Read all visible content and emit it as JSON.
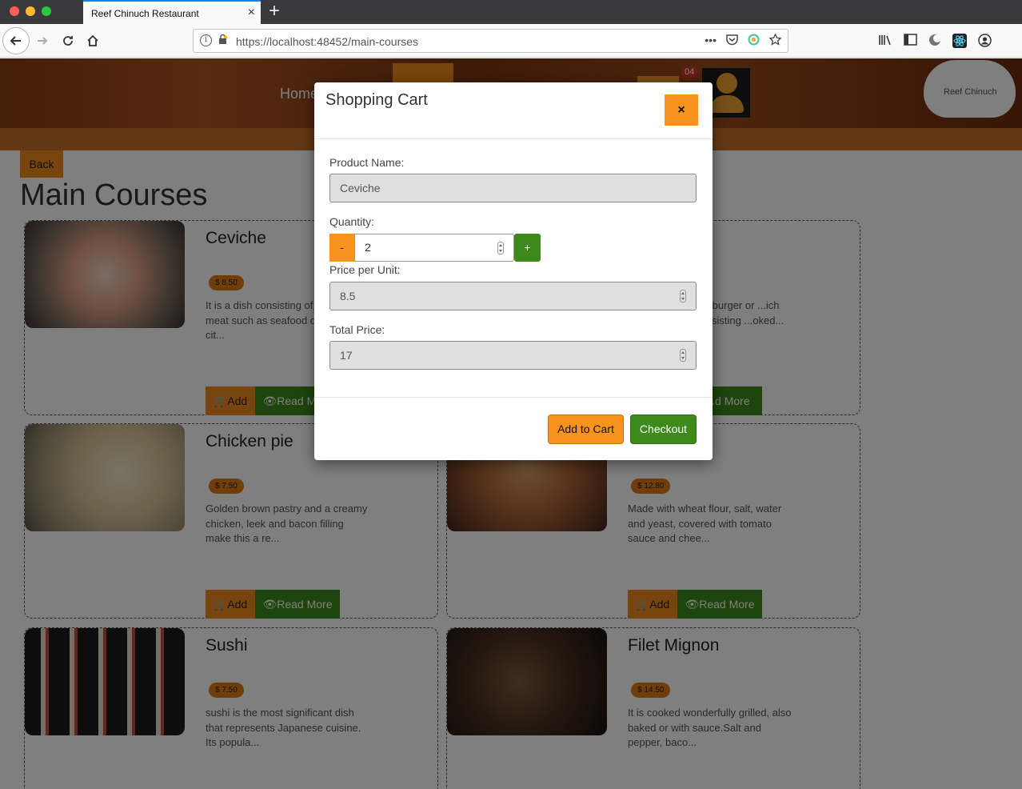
{
  "browser": {
    "tab_title": "Reef Chinuch Restaurant",
    "tab_close": "×",
    "new_tab": "+",
    "url": "https://localhost:48452/main-courses",
    "icons": [
      "back-icon",
      "forward-icon",
      "reload-icon",
      "home-icon",
      "info-icon",
      "lock-icon",
      "more-icon",
      "pocket-icon",
      "extension-icon",
      "star-icon",
      "library-icon",
      "sidebar-icon",
      "moon-icon",
      "react-icon",
      "account-icon"
    ]
  },
  "header": {
    "nav_home": "Home",
    "cart_count": "04",
    "logo_text": "Reef Chinuch"
  },
  "page": {
    "back_label": "Back",
    "title": "Main Courses"
  },
  "cards": [
    {
      "title": "Ceviche",
      "price": "$ 8.50",
      "desc": "It is a dish consisting of marinated meat such as seafood or both - in cit...",
      "add": "Add",
      "more": "Read More"
    },
    {
      "title": "",
      "price": "",
      "desc": "...efburger or ...ich consisting ...oked...",
      "add": "",
      "more": "...d More"
    },
    {
      "title": "Chicken pie",
      "price": "$ 7.50",
      "desc": "Golden brown pastry and a creamy chicken, leek and bacon filling make this a re...",
      "add": "Add",
      "more": "Read More"
    },
    {
      "title": "",
      "price": "$ 12.80",
      "desc": "Made with wheat flour, salt, water and yeast, covered with tomato sauce and chee...",
      "add": "Add",
      "more": "Read More"
    },
    {
      "title": "Sushi",
      "price": "$ 7.50",
      "desc": "sushi is the most significant dish that represents Japanese cuisine. Its popula...",
      "add": "",
      "more": ""
    },
    {
      "title": "Filet Mignon",
      "price": "$ 14.50",
      "desc": "It is cooked wonderfully grilled, also baked or with sauce.Salt and pepper, baco...",
      "add": "",
      "more": ""
    }
  ],
  "modal": {
    "title": "Shopping Cart",
    "close_symbol": "×",
    "product_name_label": "Product Name:",
    "product_name_value": "Ceviche",
    "quantity_label": "Quantity:",
    "quantity_minus": "-",
    "quantity_value": "2",
    "quantity_plus": "+",
    "price_label": "Price per Unit:",
    "price_value": "8.5",
    "total_label": "Total Price:",
    "total_value": "17",
    "add_to_cart": "Add to Cart",
    "checkout": "Checkout"
  },
  "colors": {
    "orange": "#f7931e",
    "green": "#3d8a1a",
    "overlay": "rgba(0,0,0,0.5)"
  }
}
